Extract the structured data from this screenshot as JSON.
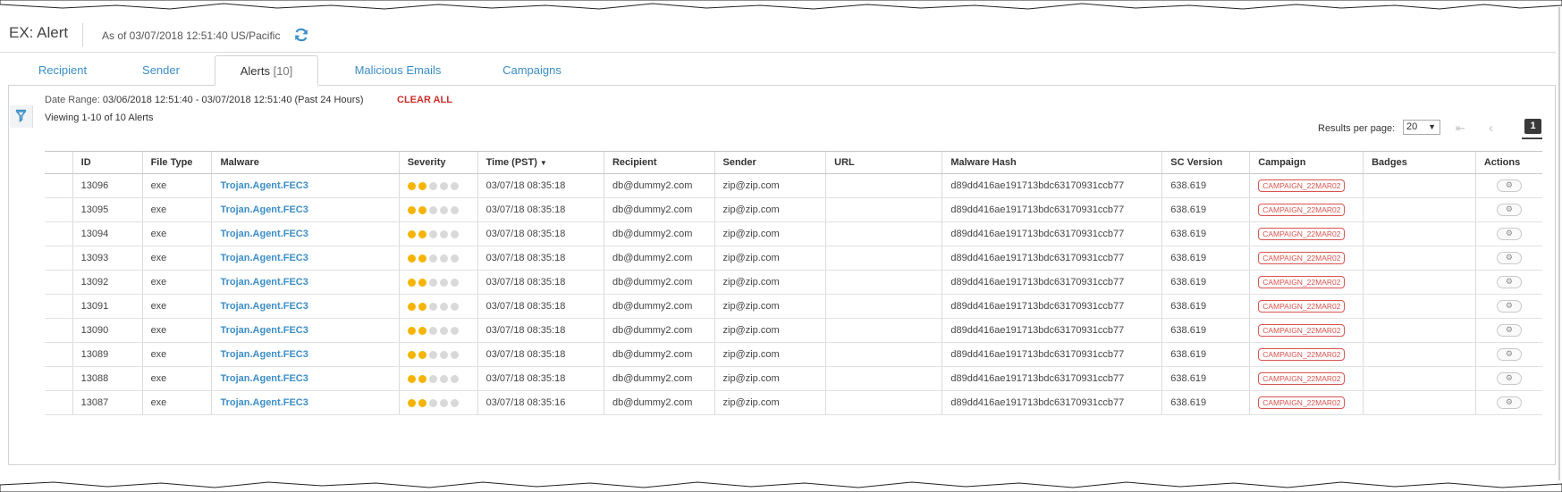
{
  "header": {
    "title": "EX: Alert",
    "as_of": "As of 03/07/2018 12:51:40 US/Pacific"
  },
  "tabs": [
    {
      "label": "Recipient"
    },
    {
      "label": "Sender"
    },
    {
      "label": "Alerts",
      "count": "[10]"
    },
    {
      "label": "Malicious Emails"
    },
    {
      "label": "Campaigns"
    }
  ],
  "filters": {
    "date_range_label": "Date Range:",
    "date_range_value": "03/06/2018 12:51:40 - 03/07/2018 12:51:40 (Past 24 Hours)",
    "clear_all": "CLEAR ALL",
    "viewing": "Viewing 1-10 of 10 Alerts"
  },
  "pagination": {
    "results_per_page_label": "Results per page:",
    "results_per_page": "20",
    "current_page": "1"
  },
  "table": {
    "columns": [
      "",
      "ID",
      "File Type",
      "Malware",
      "Severity",
      "Time (PST)",
      "Recipient",
      "Sender",
      "URL",
      "Malware Hash",
      "SC Version",
      "Campaign",
      "Badges",
      "Actions"
    ],
    "rows": [
      {
        "id": "13096",
        "file_type": "exe",
        "malware": "Trojan.Agent.FEC3",
        "severity": 2,
        "time": "03/07/18 08:35:18",
        "recipient": "db@dummy2.com",
        "sender": "zip@zip.com",
        "url": "",
        "hash": "d89dd416ae191713bdc63170931ccb77",
        "sc_version": "638.619",
        "campaign": "CAMPAIGN_22MAR02",
        "badges": ""
      },
      {
        "id": "13095",
        "file_type": "exe",
        "malware": "Trojan.Agent.FEC3",
        "severity": 2,
        "time": "03/07/18 08:35:18",
        "recipient": "db@dummy2.com",
        "sender": "zip@zip.com",
        "url": "",
        "hash": "d89dd416ae191713bdc63170931ccb77",
        "sc_version": "638.619",
        "campaign": "CAMPAIGN_22MAR02",
        "badges": ""
      },
      {
        "id": "13094",
        "file_type": "exe",
        "malware": "Trojan.Agent.FEC3",
        "severity": 2,
        "time": "03/07/18 08:35:18",
        "recipient": "db@dummy2.com",
        "sender": "zip@zip.com",
        "url": "",
        "hash": "d89dd416ae191713bdc63170931ccb77",
        "sc_version": "638.619",
        "campaign": "CAMPAIGN_22MAR02",
        "badges": ""
      },
      {
        "id": "13093",
        "file_type": "exe",
        "malware": "Trojan.Agent.FEC3",
        "severity": 2,
        "time": "03/07/18 08:35:18",
        "recipient": "db@dummy2.com",
        "sender": "zip@zip.com",
        "url": "",
        "hash": "d89dd416ae191713bdc63170931ccb77",
        "sc_version": "638.619",
        "campaign": "CAMPAIGN_22MAR02",
        "badges": ""
      },
      {
        "id": "13092",
        "file_type": "exe",
        "malware": "Trojan.Agent.FEC3",
        "severity": 2,
        "time": "03/07/18 08:35:18",
        "recipient": "db@dummy2.com",
        "sender": "zip@zip.com",
        "url": "",
        "hash": "d89dd416ae191713bdc63170931ccb77",
        "sc_version": "638.619",
        "campaign": "CAMPAIGN_22MAR02",
        "badges": ""
      },
      {
        "id": "13091",
        "file_type": "exe",
        "malware": "Trojan.Agent.FEC3",
        "severity": 2,
        "time": "03/07/18 08:35:18",
        "recipient": "db@dummy2.com",
        "sender": "zip@zip.com",
        "url": "",
        "hash": "d89dd416ae191713bdc63170931ccb77",
        "sc_version": "638.619",
        "campaign": "CAMPAIGN_22MAR02",
        "badges": ""
      },
      {
        "id": "13090",
        "file_type": "exe",
        "malware": "Trojan.Agent.FEC3",
        "severity": 2,
        "time": "03/07/18 08:35:18",
        "recipient": "db@dummy2.com",
        "sender": "zip@zip.com",
        "url": "",
        "hash": "d89dd416ae191713bdc63170931ccb77",
        "sc_version": "638.619",
        "campaign": "CAMPAIGN_22MAR02",
        "badges": ""
      },
      {
        "id": "13089",
        "file_type": "exe",
        "malware": "Trojan.Agent.FEC3",
        "severity": 2,
        "time": "03/07/18 08:35:18",
        "recipient": "db@dummy2.com",
        "sender": "zip@zip.com",
        "url": "",
        "hash": "d89dd416ae191713bdc63170931ccb77",
        "sc_version": "638.619",
        "campaign": "CAMPAIGN_22MAR02",
        "badges": ""
      },
      {
        "id": "13088",
        "file_type": "exe",
        "malware": "Trojan.Agent.FEC3",
        "severity": 2,
        "time": "03/07/18 08:35:18",
        "recipient": "db@dummy2.com",
        "sender": "zip@zip.com",
        "url": "",
        "hash": "d89dd416ae191713bdc63170931ccb77",
        "sc_version": "638.619",
        "campaign": "CAMPAIGN_22MAR02",
        "badges": ""
      },
      {
        "id": "13087",
        "file_type": "exe",
        "malware": "Trojan.Agent.FEC3",
        "severity": 2,
        "time": "03/07/18 08:35:16",
        "recipient": "db@dummy2.com",
        "sender": "zip@zip.com",
        "url": "",
        "hash": "d89dd416ae191713bdc63170931ccb77",
        "sc_version": "638.619",
        "campaign": "CAMPAIGN_22MAR02",
        "badges": ""
      }
    ]
  },
  "icons": {
    "refresh": "refresh-icon",
    "filter": "filter-icon",
    "sort": "sort-desc-icon",
    "first_page": "first-page-icon",
    "prev_page": "prev-page-icon",
    "actions": "gear-icon"
  },
  "colors": {
    "link": "#3b8ec8",
    "clear_all": "#c9302c",
    "severity_on": "#f5b400",
    "severity_off": "#d9d9d9",
    "campaign": "#d9534f"
  }
}
